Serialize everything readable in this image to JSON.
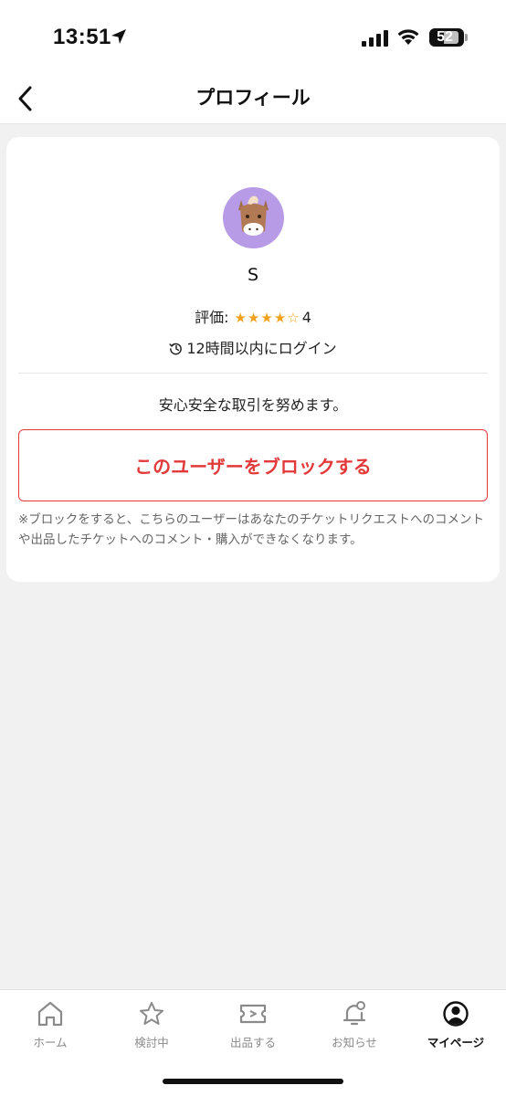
{
  "status_bar": {
    "time": "13:51",
    "battery": "52",
    "icons": [
      "location-arrow-icon",
      "signal-icon",
      "wifi-icon",
      "battery-icon"
    ]
  },
  "header": {
    "title": "プロフィール",
    "back_icon": "chevron-left-icon"
  },
  "profile": {
    "avatar_icon": "horse-avatar-icon",
    "avatar_bg_color": "#b79be6",
    "name": "S",
    "rating_label": "評価:",
    "rating_stars_filled": "★★★★",
    "rating_stars_empty": "☆",
    "rating_value": "4",
    "last_login": "12時間以内にログイン",
    "bio": "安心安全な取引を努めます。"
  },
  "block": {
    "button_label": "このユーザーをブロックする",
    "note": "※ブロックをすると、こちらのユーザーはあなたのチケットリクエストへのコメントや出品したチケットへのコメント・購入ができなくなります。",
    "accent_color": "#e23a3a"
  },
  "tab_bar": {
    "tabs": [
      {
        "label": "ホーム",
        "icon": "home-icon",
        "active": false
      },
      {
        "label": "検討中",
        "icon": "star-icon",
        "active": false
      },
      {
        "label": "出品する",
        "icon": "ticket-icon",
        "active": false
      },
      {
        "label": "お知らせ",
        "icon": "bell-icon",
        "active": false
      },
      {
        "label": "マイページ",
        "icon": "user-circle-icon",
        "active": true
      }
    ]
  }
}
